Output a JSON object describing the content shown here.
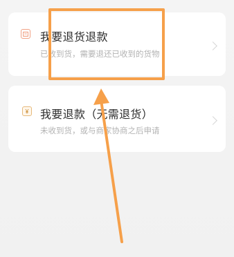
{
  "options": [
    {
      "title": "我要退货退款",
      "subtitle": "已收到货，需要退还已收到的货物",
      "icon": "return-box-icon"
    },
    {
      "title": "我要退款（无需退货）",
      "subtitle": "未收到货，或与商家协商之后申请",
      "icon": "refund-yen-icon"
    }
  ],
  "annotation": {
    "color": "#f6a04a",
    "highlight": "box",
    "arrow": "up"
  }
}
